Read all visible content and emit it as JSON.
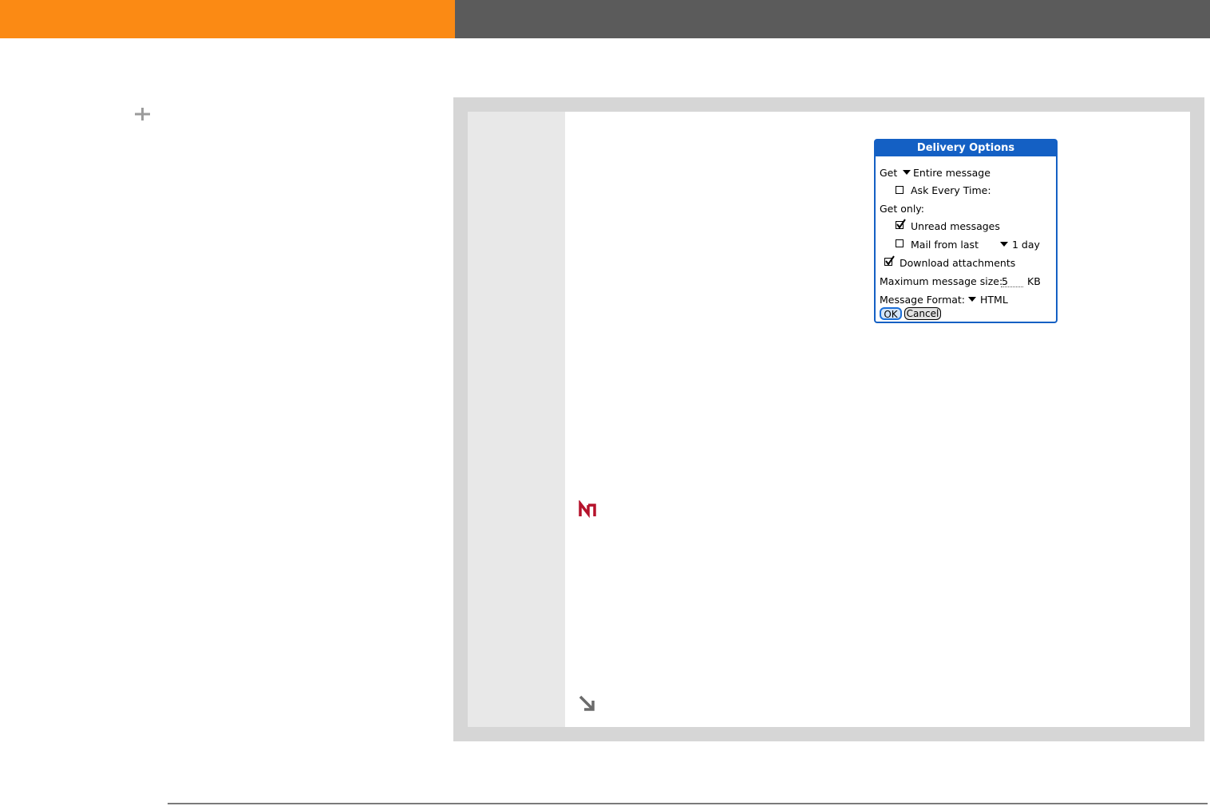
{
  "dialog": {
    "title": "Delivery Options",
    "get_label": "Get",
    "get_value": "Entire message",
    "ask_every_time": {
      "label": "Ask Every Time:",
      "checked": false
    },
    "get_only_label": "Get only:",
    "unread_messages": {
      "label": "Unread messages",
      "checked": true
    },
    "mail_from_last": {
      "label": "Mail from last",
      "checked": false,
      "value": "1 day"
    },
    "download_attachments": {
      "label": "Download attachments",
      "checked": true
    },
    "max_size_label": "Maximum message size:",
    "max_size_value": "5",
    "max_size_unit": "KB",
    "format_label": "Message Format:",
    "format_value": "HTML",
    "ok_label": "OK",
    "cancel_label": "Cancel"
  },
  "colors": {
    "header_orange": "#fb8a14",
    "header_gray": "#5b5b5b",
    "dialog_blue": "#1460c4",
    "tip_red": "#b5122c"
  },
  "icons": {
    "plus": "plus-icon",
    "tip": "tip-icon",
    "continue": "arrow-down-right-icon"
  }
}
